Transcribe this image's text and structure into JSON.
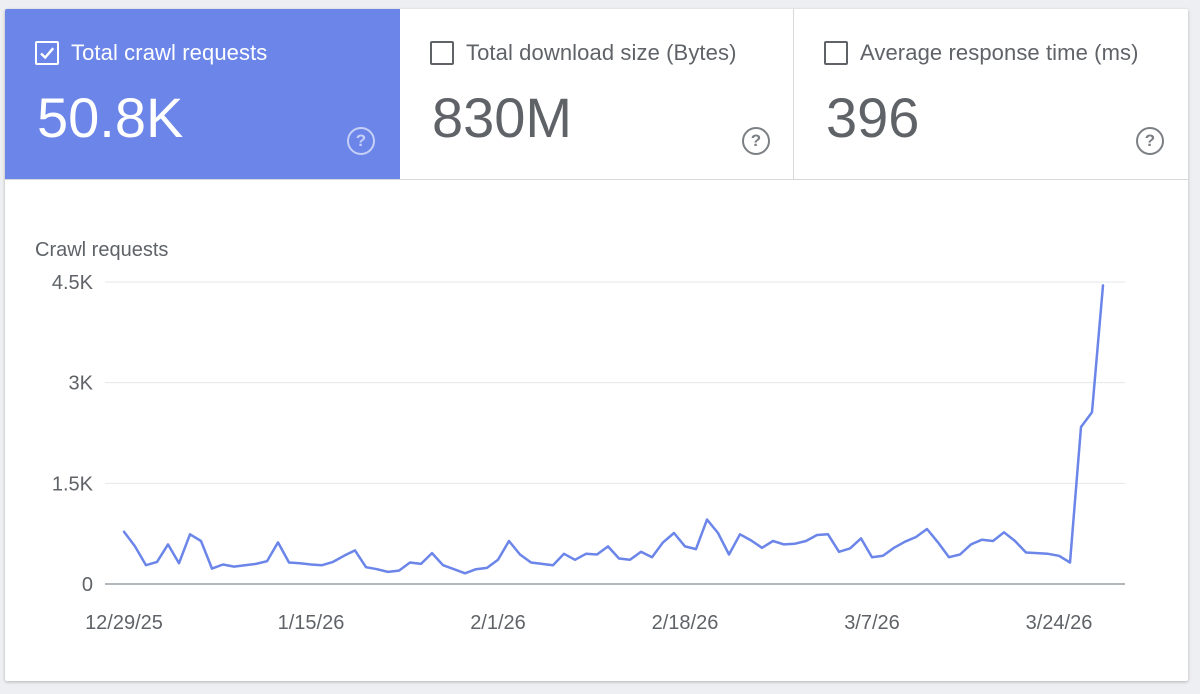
{
  "tiles": [
    {
      "label": "Total crawl requests",
      "value": "50.8K",
      "checked": true
    },
    {
      "label": "Total download size (Bytes)",
      "value": "830M",
      "checked": false
    },
    {
      "label": "Average response time (ms)",
      "value": "396",
      "checked": false
    }
  ],
  "colors": {
    "accent": "#6b85e9",
    "line": "#6b85e9",
    "grid": "#e6e7e9",
    "axis": "#9aa0a6"
  },
  "chart_data": {
    "type": "line",
    "title": "Crawl requests",
    "xlabel": "",
    "ylabel": "",
    "ylim": [
      0,
      4500
    ],
    "y_ticks": [
      0,
      1500,
      3000,
      4500
    ],
    "y_tick_labels": [
      "0",
      "1.5K",
      "3K",
      "4.5K"
    ],
    "x_tick_labels": [
      "12/29/25",
      "1/15/26",
      "2/1/26",
      "2/18/26",
      "3/7/26",
      "3/24/26"
    ],
    "x_tick_index": [
      0,
      17,
      34,
      51,
      68,
      85
    ],
    "grid": true,
    "series": [
      {
        "values": [
          780,
          560,
          280,
          330,
          590,
          310,
          740,
          640,
          230,
          290,
          260,
          280,
          300,
          340,
          620,
          320,
          310,
          290,
          280,
          330,
          420,
          500,
          250,
          220,
          180,
          200,
          320,
          300,
          460,
          280,
          220,
          160,
          220,
          240,
          360,
          640,
          440,
          320,
          300,
          280,
          450,
          360,
          450,
          440,
          560,
          380,
          360,
          480,
          400,
          620,
          760,
          560,
          520,
          960,
          760,
          440,
          740,
          650,
          540,
          640,
          590,
          600,
          640,
          730,
          740,
          480,
          530,
          680,
          400,
          420,
          540,
          630,
          700,
          820,
          620,
          400,
          440,
          590,
          660,
          640,
          770,
          640,
          470,
          460,
          450,
          420,
          320,
          2340,
          2560,
          4450
        ]
      }
    ]
  }
}
